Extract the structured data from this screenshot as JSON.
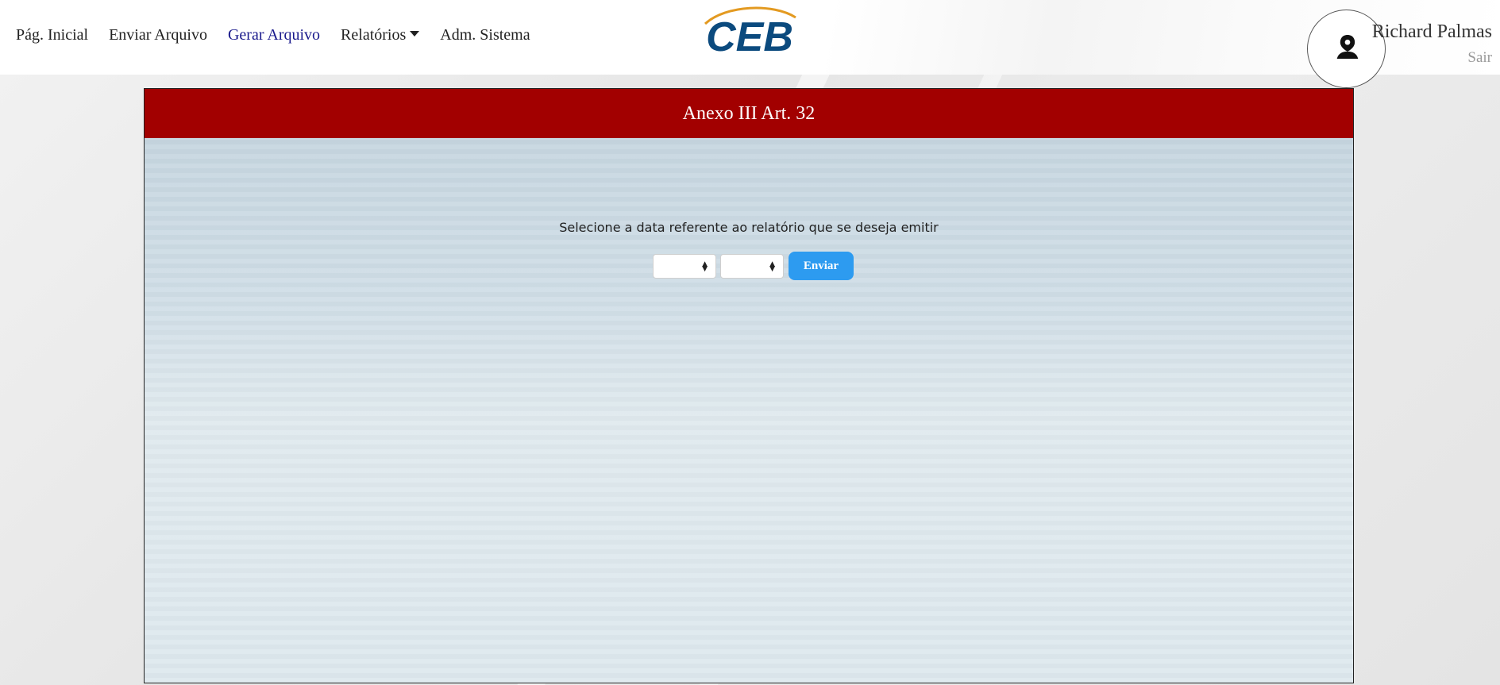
{
  "nav": {
    "items": [
      {
        "label": "Pág. Inicial",
        "active": false
      },
      {
        "label": "Enviar Arquivo",
        "active": false
      },
      {
        "label": "Gerar Arquivo",
        "active": true
      },
      {
        "label": "Relatórios",
        "active": false,
        "has_dropdown": true
      },
      {
        "label": "Adm. Sistema",
        "active": false
      }
    ]
  },
  "brand": {
    "logo_text": "CEB",
    "primary_color": "#0b4a7e",
    "accent_color": "#e39a21"
  },
  "user": {
    "name": "Richard Palmas",
    "logout_label": "Sair",
    "avatar_icon": "user-silhouette-icon"
  },
  "panel": {
    "title": "Anexo III Art. 32",
    "header_color": "#a20000",
    "prompt": "Selecione a data referente ao relatório que se deseja emitir",
    "month_select": {
      "value": ""
    },
    "year_select": {
      "value": ""
    },
    "submit_label": "Enviar",
    "submit_color": "#2d9bf0"
  }
}
